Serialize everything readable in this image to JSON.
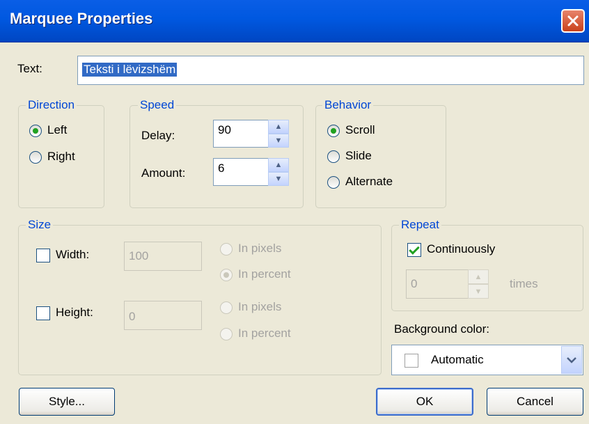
{
  "window": {
    "title": "Marquee Properties"
  },
  "text": {
    "label": "Text:",
    "value": "Teksti i lëvizshëm"
  },
  "direction": {
    "legend": "Direction",
    "left": "Left",
    "right": "Right",
    "selected": "Left"
  },
  "speed": {
    "legend": "Speed",
    "delay_label": "Delay:",
    "delay": "90",
    "amount_label": "Amount:",
    "amount": "6"
  },
  "behavior": {
    "legend": "Behavior",
    "scroll": "Scroll",
    "slide": "Slide",
    "alternate": "Alternate",
    "selected": "Scroll"
  },
  "size": {
    "legend": "Size",
    "width_label": "Width:",
    "width_value": "100",
    "width_checked": false,
    "width_unit_pixels": "In pixels",
    "width_unit_percent": "In percent",
    "width_unit_selected": "In percent",
    "height_label": "Height:",
    "height_value": "0",
    "height_checked": false,
    "height_unit_pixels": "In pixels",
    "height_unit_percent": "In percent"
  },
  "repeat": {
    "legend": "Repeat",
    "continuously": "Continuously",
    "continuously_checked": true,
    "times_value": "0",
    "times_label": "times"
  },
  "background": {
    "label": "Background color:",
    "value": "Automatic"
  },
  "buttons": {
    "style": "Style...",
    "ok": "OK",
    "cancel": "Cancel"
  },
  "icons": {
    "close": "close-icon",
    "spin_up": "spin-up-icon",
    "spin_down": "spin-down-icon",
    "dropdown": "chevron-down-icon"
  },
  "colors": {
    "titlebar": "#0058E0",
    "legend": "#0046D5",
    "selection": "#316AC5",
    "close": "#C9411A"
  }
}
